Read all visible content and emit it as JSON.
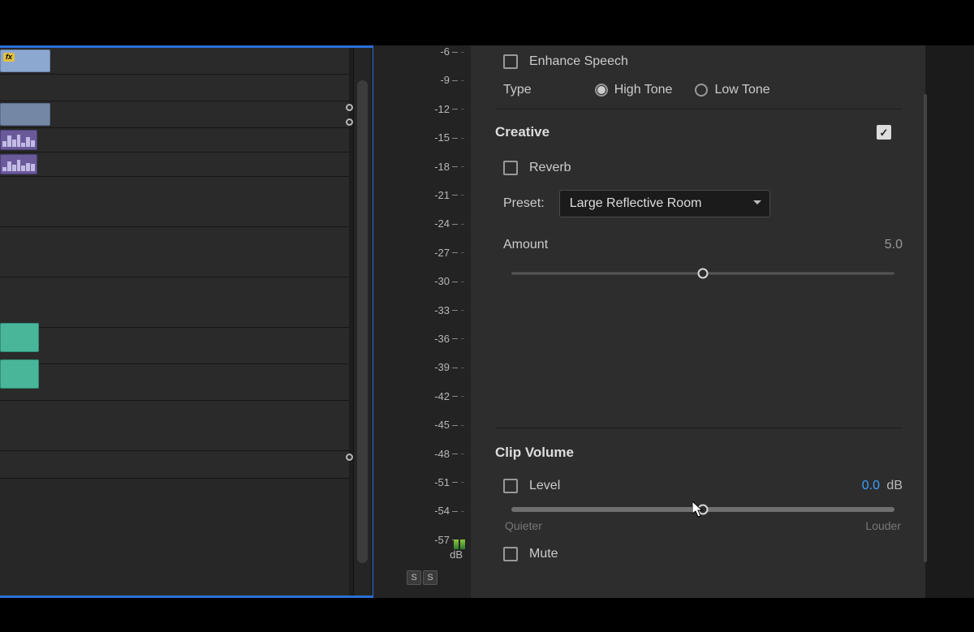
{
  "timeline": {
    "fx_label": "fx"
  },
  "meter": {
    "ticks": [
      "-6",
      "-9",
      "-12",
      "-15",
      "-18",
      "-21",
      "-24",
      "-27",
      "-30",
      "-33",
      "-36",
      "-39",
      "-42",
      "-45",
      "-48",
      "-51",
      "-54",
      "-57"
    ],
    "unit": "dB",
    "solo": [
      "S",
      "S"
    ]
  },
  "panel": {
    "enhance_speech": {
      "label": "Enhance Speech",
      "checked": false
    },
    "type": {
      "label": "Type",
      "options": [
        {
          "label": "High Tone",
          "selected": true
        },
        {
          "label": "Low Tone",
          "selected": false
        }
      ]
    },
    "creative": {
      "title": "Creative",
      "enabled": true,
      "reverb": {
        "label": "Reverb",
        "checked": false
      },
      "preset": {
        "label": "Preset:",
        "value": "Large Reflective Room"
      },
      "amount": {
        "label": "Amount",
        "value": "5.0",
        "position_pct": 50
      }
    },
    "clip_volume": {
      "title": "Clip Volume",
      "level": {
        "label": "Level",
        "checked": false,
        "value": "0.0",
        "unit": "dB",
        "position_pct": 50
      },
      "quieter": "Quieter",
      "louder": "Louder",
      "mute": {
        "label": "Mute",
        "checked": false
      }
    }
  }
}
